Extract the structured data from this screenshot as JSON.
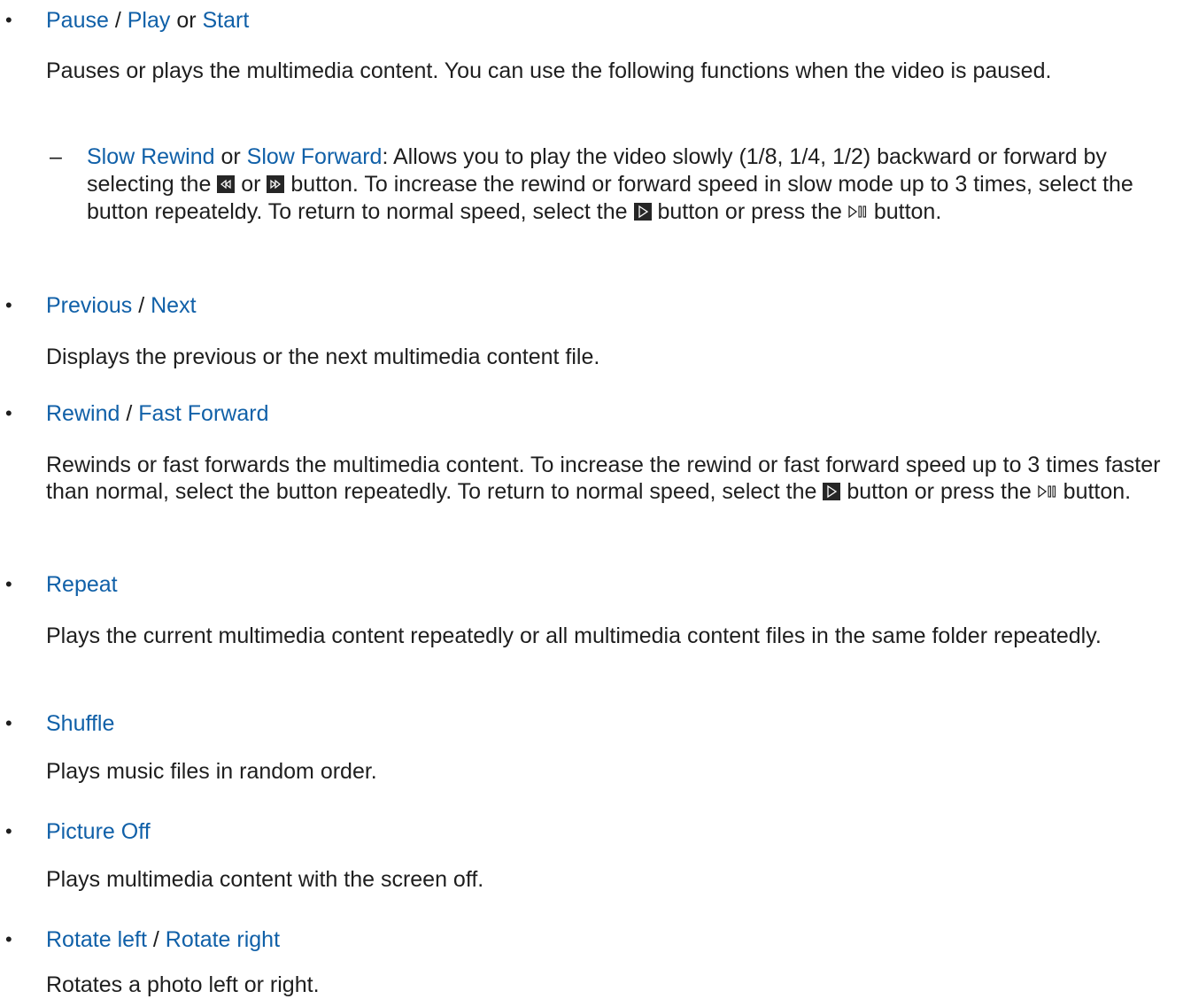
{
  "items": [
    {
      "heading": {
        "a": "Pause",
        "sep1": " / ",
        "b": "Play",
        "sep2": " or ",
        "c": "Start"
      },
      "desc": "Pauses or plays the multimedia content. You can use the following functions when the video is paused.",
      "sub": {
        "a": "Slow Rewind",
        "or": " or ",
        "b": "Slow Forward",
        "t1": ": Allows you to play the video slowly (1/8, 1/4, 1/2) backward or forward by selecting the ",
        "t2": " or ",
        "t3": " button. To increase the rewind or forward speed in slow mode up to 3 times, select the button repeateldy. To return to normal speed, select the ",
        "t4": " button or press the ",
        "t5": " button."
      }
    },
    {
      "heading": {
        "a": "Previous",
        "sep1": " / ",
        "b": "Next"
      },
      "desc": "Displays the previous or the next multimedia content file."
    },
    {
      "heading": {
        "a": "Rewind",
        "sep1": " / ",
        "b": "Fast Forward"
      },
      "desc": {
        "t1": "Rewinds or fast forwards the multimedia content. To increase the rewind or fast forward speed up to 3 times faster than normal, select the button repeatedly. To return to normal speed, select the ",
        "t2": " button or press the ",
        "t3": " button."
      }
    },
    {
      "heading": {
        "a": "Repeat"
      },
      "desc": "Plays the current multimedia content repeatedly or all multimedia content files in the same folder repeatedly."
    },
    {
      "heading": {
        "a": "Shuffle"
      },
      "desc": "Plays music files in random order."
    },
    {
      "heading": {
        "a": "Picture Off"
      },
      "desc": "Plays multimedia content with the screen off."
    },
    {
      "heading": {
        "a": "Rotate left",
        "sep1": " / ",
        "b": "Rotate right"
      },
      "desc": "Rotates a photo left or right."
    }
  ],
  "symbols": {
    "bullet": "•",
    "dash": "–"
  },
  "colors": {
    "link": "#1060a8",
    "text": "#1e1e1e",
    "icon_bg": "#262626"
  },
  "icons": {
    "slow_rewind": "slow-rewind-icon",
    "slow_forward": "slow-forward-icon",
    "play": "play-icon",
    "play_pause": "play-pause-icon"
  }
}
